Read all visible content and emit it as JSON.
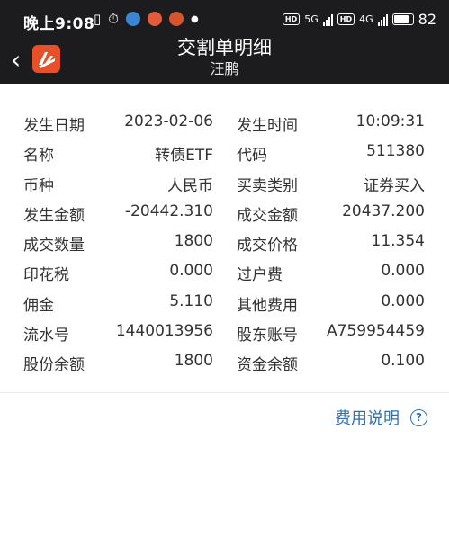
{
  "status_bar": {
    "time": "晚上9:08",
    "network_5g": "5G",
    "network_4g": "4G",
    "battery": "82"
  },
  "header": {
    "title": "交割单明细",
    "subtitle": "汪鹏"
  },
  "rows": [
    {
      "l1": "发生日期",
      "v1": "2023-02-06",
      "l2": "发生时间",
      "v2": "10:09:31"
    },
    {
      "l1": "名称",
      "v1": "转债ETF",
      "l2": "代码",
      "v2": "511380"
    },
    {
      "l1": "币种",
      "v1": "人民币",
      "l2": "买卖类别",
      "v2": "证券买入"
    },
    {
      "l1": "发生金额",
      "v1": "-20442.310",
      "l2": "成交金额",
      "v2": "20437.200"
    },
    {
      "l1": "成交数量",
      "v1": "1800",
      "l2": "成交价格",
      "v2": "11.354"
    },
    {
      "l1": "印花税",
      "v1": "0.000",
      "l2": "过户费",
      "v2": "0.000"
    },
    {
      "l1": "佣金",
      "v1": "5.110",
      "l2": "其他费用",
      "v2": "0.000"
    },
    {
      "l1": "流水号",
      "v1": "1440013956",
      "l2": "股东账号",
      "v2": "A759954459"
    },
    {
      "l1": "股份余额",
      "v1": "1800",
      "l2": "资金余额",
      "v2": "0.100"
    }
  ],
  "help": {
    "label": "费用说明",
    "icon": "?"
  },
  "colors": {
    "header_bg": "#1c1c1e",
    "link": "#2e6fb8",
    "logo": "#e8502a"
  }
}
